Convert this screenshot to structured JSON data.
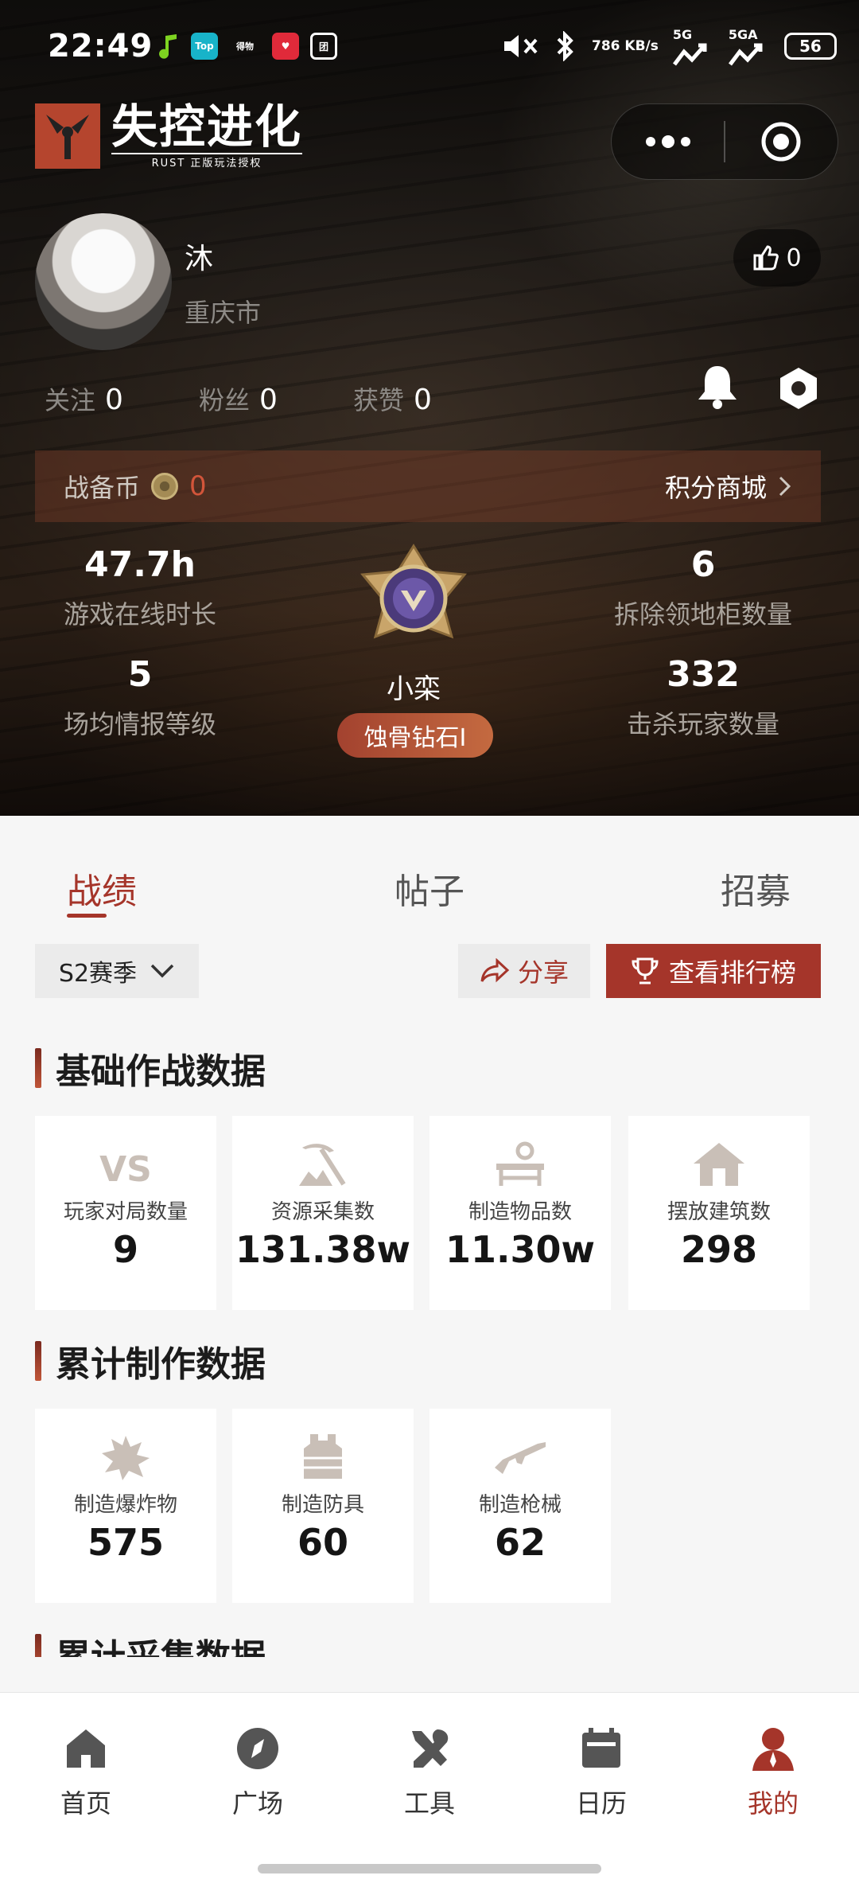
{
  "status_bar": {
    "time": "22:49",
    "app_icons": [
      "Top",
      "得物"
    ],
    "net_speed": "786 KB/s",
    "sig1": "5G",
    "sig2": "5GA",
    "battery": "56"
  },
  "header": {
    "logo_title": "失控进化",
    "logo_sub": "RUST 正版玩法授权"
  },
  "profile": {
    "name": "沐",
    "city": "重庆市",
    "likes": "0",
    "follow_label": "关注",
    "follow_value": "0",
    "fans_label": "粉丝",
    "fans_value": "0",
    "praised_label": "获赞",
    "praised_value": "0"
  },
  "coin_bar": {
    "label": "战备币",
    "value": "0",
    "mall_label": "积分商城"
  },
  "stats": {
    "online_value": "47.7h",
    "online_label": "游戏在线时长",
    "demolish_value": "6",
    "demolish_label": "拆除领地柜数量",
    "intel_value": "5",
    "intel_label": "场均情报等级",
    "kills_value": "332",
    "kills_label": "击杀玩家数量",
    "rank_name": "小栾",
    "rank_tier": "蚀骨钻石I"
  },
  "tabs": [
    "战绩",
    "帖子",
    "招募"
  ],
  "controls": {
    "season": "S2赛季",
    "share": "分享",
    "leaderboard": "查看排行榜"
  },
  "sections": {
    "basic_title": "基础作战数据",
    "craft_title": "累计制作数据",
    "gather_title": "累计采集数据"
  },
  "basic_cards": [
    {
      "label": "玩家对局数量",
      "value": "9",
      "icon": "vs-icon"
    },
    {
      "label": "资源采集数",
      "value": "131.38w",
      "icon": "pickaxe-icon"
    },
    {
      "label": "制造物品数",
      "value": "11.30w",
      "icon": "workbench-icon"
    },
    {
      "label": "摆放建筑数",
      "value": "298",
      "icon": "house-icon"
    }
  ],
  "craft_cards": [
    {
      "label": "制造爆炸物",
      "value": "575",
      "icon": "explosive-icon"
    },
    {
      "label": "制造防具",
      "value": "60",
      "icon": "armor-icon"
    },
    {
      "label": "制造枪械",
      "value": "62",
      "icon": "rifle-icon"
    }
  ],
  "nav": [
    {
      "label": "首页",
      "icon": "home-icon"
    },
    {
      "label": "广场",
      "icon": "compass-icon"
    },
    {
      "label": "工具",
      "icon": "tools-icon"
    },
    {
      "label": "日历",
      "icon": "calendar-icon"
    },
    {
      "label": "我的",
      "icon": "profile-icon"
    }
  ],
  "colors": {
    "accent": "#a5352a",
    "badge_pill": "#b8523a"
  }
}
